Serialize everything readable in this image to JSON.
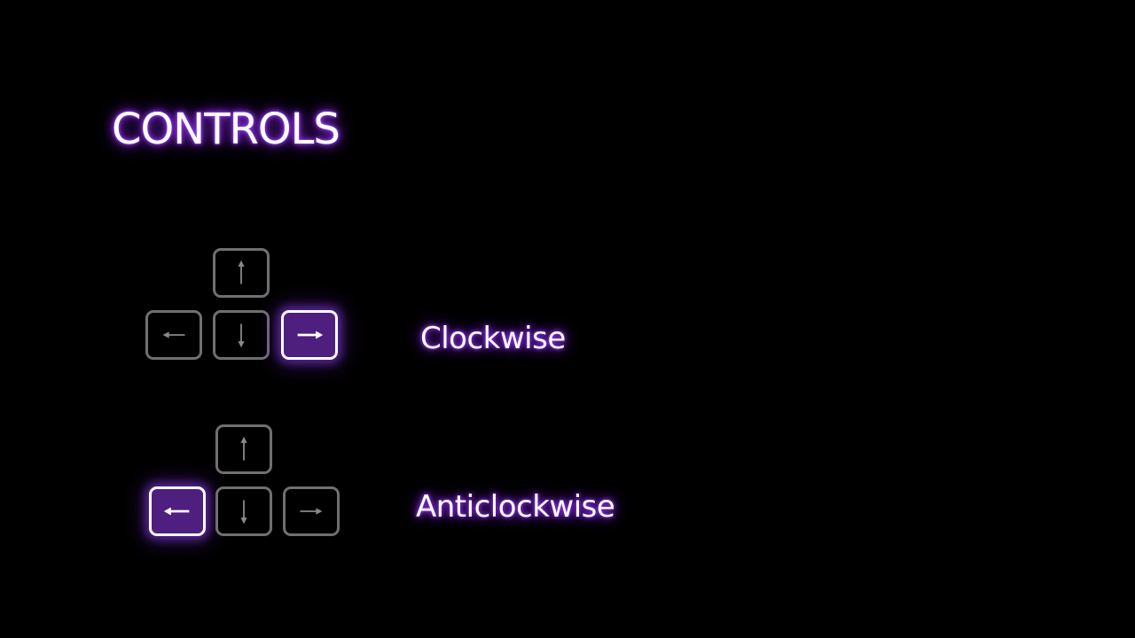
{
  "screen": {
    "title": "CONTROLS"
  },
  "controls": [
    {
      "action_label": "Clockwise",
      "active_key": "right"
    },
    {
      "action_label": "Anticlockwise",
      "active_key": "left"
    }
  ],
  "colors": {
    "background": "#000000",
    "glow": "#8a2be2",
    "key_inactive_border": "#707070",
    "key_active_fill": "#4e1f7e",
    "text": "#ffffff"
  },
  "icons": {
    "up": "arrow-up-icon",
    "down": "arrow-down-icon",
    "left": "arrow-left-icon",
    "right": "arrow-right-icon"
  }
}
